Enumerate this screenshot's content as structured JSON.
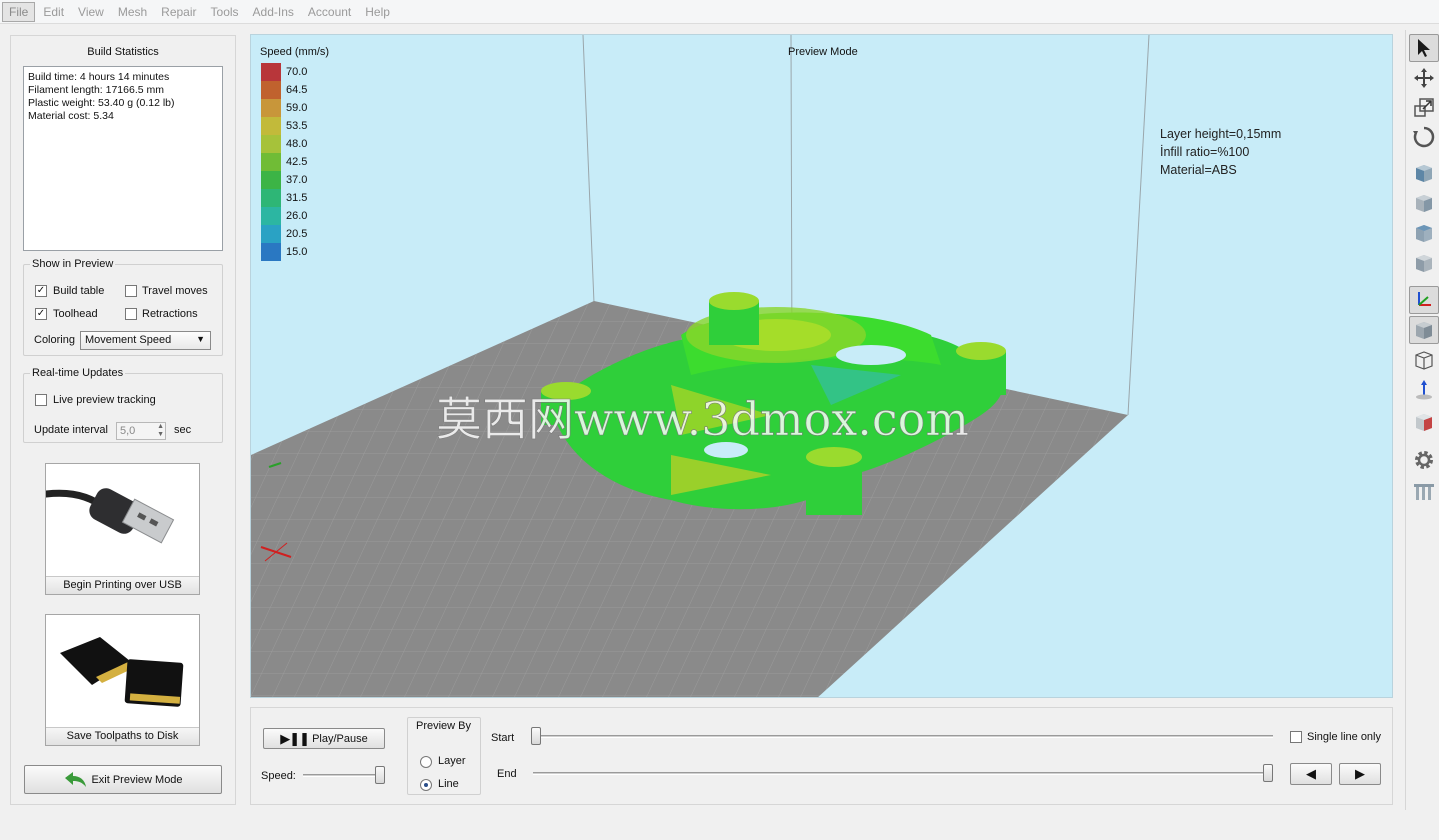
{
  "menu": {
    "items": [
      "File",
      "Edit",
      "View",
      "Mesh",
      "Repair",
      "Tools",
      "Add-Ins",
      "Account",
      "Help"
    ]
  },
  "build_stats": {
    "title": "Build Statistics",
    "lines": [
      "Build time: 4 hours 14 minutes",
      "Filament length: 17166.5 mm",
      "Plastic weight: 53.40 g (0.12 lb)",
      "Material cost: 5.34"
    ]
  },
  "show_in_preview": {
    "title": "Show in Preview",
    "build_table": "Build table",
    "travel_moves": "Travel moves",
    "toolhead": "Toolhead",
    "retractions": "Retractions",
    "coloring_label": "Coloring",
    "coloring_value": "Movement Speed"
  },
  "realtime": {
    "title": "Real-time Updates",
    "live_preview": "Live preview tracking",
    "interval_label": "Update interval",
    "interval_value": "5,0",
    "interval_unit": "sec"
  },
  "actions": {
    "usb": "Begin Printing over USB",
    "save": "Save Toolpaths to Disk",
    "exit": "Exit Preview Mode"
  },
  "viewport": {
    "title": "Preview Mode",
    "legend_title": "Speed (mm/s)",
    "legend": [
      {
        "label": "70.0",
        "color": "#b8363a"
      },
      {
        "label": "64.5",
        "color": "#c0622e"
      },
      {
        "label": "59.0",
        "color": "#c8963a"
      },
      {
        "label": "53.5",
        "color": "#c2ba3a"
      },
      {
        "label": "48.0",
        "color": "#a6c23a"
      },
      {
        "label": "42.5",
        "color": "#70bc36"
      },
      {
        "label": "37.0",
        "color": "#3cb446"
      },
      {
        "label": "31.5",
        "color": "#2eb676"
      },
      {
        "label": "26.0",
        "color": "#2cb6a2"
      },
      {
        "label": "20.5",
        "color": "#2aa2c4"
      },
      {
        "label": "15.0",
        "color": "#2a78c2"
      }
    ],
    "notes": [
      "Layer height=0,15mm",
      "İnfill ratio=%100",
      "Material=ABS"
    ],
    "watermark": "莫西网www.3dmox.com"
  },
  "controls": {
    "play_pause": "Play/Pause",
    "speed_label": "Speed:",
    "preview_by_title": "Preview By",
    "layer": "Layer",
    "line": "Line",
    "start": "Start",
    "end": "End",
    "single_line": "Single line only"
  },
  "toolbar": {
    "icons": [
      "select-arrow-icon",
      "move-icon",
      "scale-icon",
      "rotate-icon",
      "view-cube-front-icon",
      "view-cube-side-icon",
      "view-cube-top-icon",
      "view-cube-iso-icon",
      "axes-icon",
      "solid-cube-icon",
      "wireframe-cube-icon",
      "z-axis-icon",
      "cut-cube-icon",
      "settings-gear-icon",
      "support-icon"
    ]
  }
}
